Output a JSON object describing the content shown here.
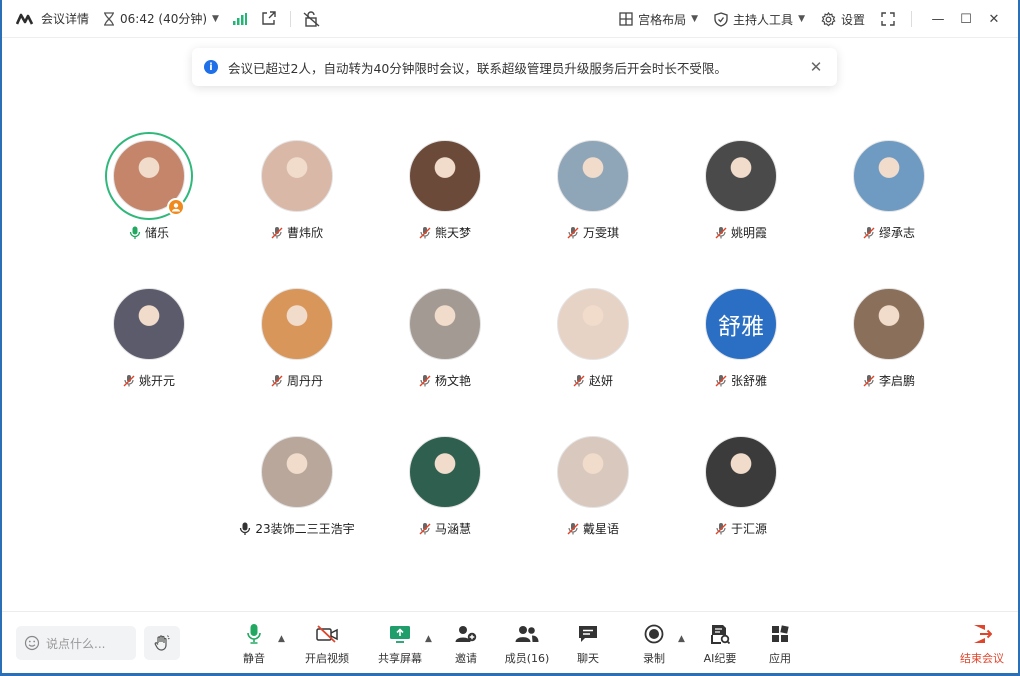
{
  "topbar": {
    "meeting_details": "会议详情",
    "timer": "06:42 (40分钟)",
    "layout": "宫格布局",
    "host_tools": "主持人工具",
    "settings": "设置",
    "colors": {
      "signal": "#22b573",
      "text": "#333333"
    }
  },
  "notice": {
    "text": "会议已超过2人，自动转为40分钟限时会议，联系超级管理员升级服务后开会时长不受限。"
  },
  "participants": [
    {
      "name": "储乐",
      "mic": "speaking",
      "host": true
    },
    {
      "name": "曹炜欣",
      "mic": "muted"
    },
    {
      "name": "熊天梦",
      "mic": "muted"
    },
    {
      "name": "万雯琪",
      "mic": "muted"
    },
    {
      "name": "姚明霞",
      "mic": "muted"
    },
    {
      "name": "缪承志",
      "mic": "muted"
    },
    {
      "name": "姚开元",
      "mic": "muted"
    },
    {
      "name": "周丹丹",
      "mic": "muted"
    },
    {
      "name": "杨文艳",
      "mic": "muted"
    },
    {
      "name": "赵妍",
      "mic": "muted"
    },
    {
      "name": "张舒雅",
      "mic": "muted",
      "initials": "舒雅"
    },
    {
      "name": "李启鹏",
      "mic": "muted"
    },
    {
      "name": "23装饰二三王浩宇",
      "mic": "on"
    },
    {
      "name": "马涵慧",
      "mic": "muted"
    },
    {
      "name": "戴星语",
      "mic": "muted"
    },
    {
      "name": "于汇源",
      "mic": "muted"
    }
  ],
  "bottombar": {
    "chat_placeholder": "说点什么...",
    "mute": "静音",
    "video": "开启视频",
    "share": "共享屏幕",
    "invite": "邀请",
    "members": "成员(16)",
    "chat": "聊天",
    "record": "录制",
    "ai_notes": "AI纪要",
    "apps": "应用",
    "end": "结束会议",
    "colors": {
      "mic_green": "#22a861",
      "end_red": "#e0452b",
      "share_green": "#1f9d6a"
    }
  }
}
